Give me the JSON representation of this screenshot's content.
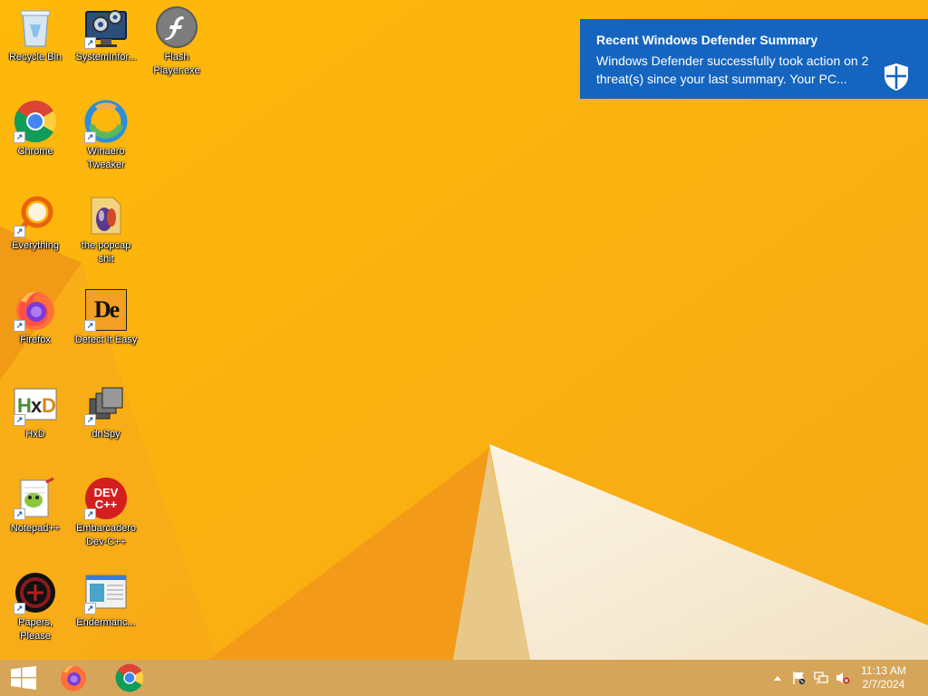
{
  "desktop": {
    "icons": [
      {
        "label": "Recycle Bin",
        "icon": "recycle-bin-icon"
      },
      {
        "label": "SystemInfor...",
        "icon": "system-information-icon"
      },
      {
        "label": "Flash Player.exe",
        "icon": "flash-player-icon"
      },
      {
        "label": "Chrome",
        "icon": "chrome-icon"
      },
      {
        "label": "Winaero Tweaker",
        "icon": "winaero-tweaker-icon"
      },
      {
        "label": "Everything",
        "icon": "everything-search-icon"
      },
      {
        "label": "the popcap shit",
        "icon": "folder-icon"
      },
      {
        "label": "Firefox",
        "icon": "firefox-icon"
      },
      {
        "label": "Detect It Easy",
        "icon": "detect-it-easy-icon"
      },
      {
        "label": "HxD",
        "icon": "hxd-icon"
      },
      {
        "label": "dnSpy",
        "icon": "dnspy-icon"
      },
      {
        "label": "Notepad++",
        "icon": "notepad-plus-plus-icon"
      },
      {
        "label": "Embarcadero Dev-C++",
        "icon": "dev-cpp-icon"
      },
      {
        "label": "Papers, Please",
        "icon": "papers-please-icon"
      },
      {
        "label": "Endermanc...",
        "icon": "endermanch-icon"
      }
    ],
    "dev_cpp_icon_text": "DEV C++",
    "detect_it_easy_text": "De"
  },
  "notification": {
    "title": "Recent Windows Defender Summary",
    "body": "Windows Defender successfully took action on 2 threat(s) since your last summary. Your PC..."
  },
  "taskbar": {
    "pinned": [
      {
        "name": "Firefox",
        "icon": "firefox-icon"
      },
      {
        "name": "Chrome",
        "icon": "chrome-icon"
      }
    ],
    "clock": {
      "time": "11:13 AM",
      "date": "2/7/2024"
    }
  },
  "colors": {
    "wallpaper_orange": "#f7b00c",
    "toast_blue": "#1565c0",
    "taskbar": "#d5a55a"
  }
}
